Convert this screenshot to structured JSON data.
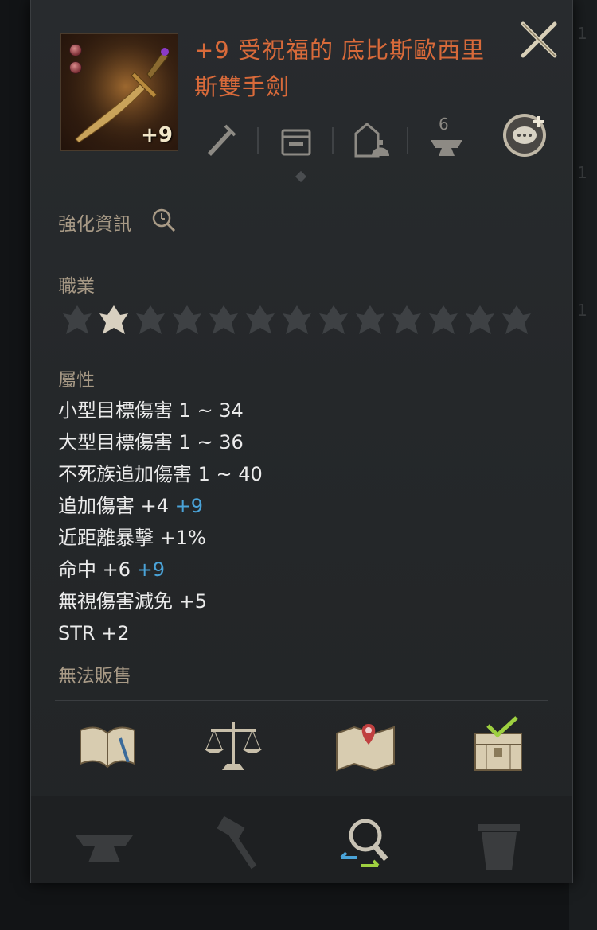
{
  "background": {
    "row_numbers": [
      "1",
      "1",
      "1"
    ]
  },
  "item": {
    "title": "+9 受祝福的 底比斯歐西里斯雙手劍",
    "enhance_badge": "+9",
    "thumbnail_icon": "two-handed-sword-icon"
  },
  "header_icons": {
    "count_badge": "6",
    "items": [
      "sword-type-icon",
      "storage-icon",
      "character-bag-icon",
      "anvil-icon",
      "chat-share-icon"
    ]
  },
  "sections": {
    "enhance_info_label": "強化資訊",
    "class_label": "職業",
    "attributes_label": "屬性"
  },
  "classes": [
    "class-1",
    "class-2",
    "class-3",
    "class-4",
    "class-5",
    "class-6",
    "class-7",
    "class-8",
    "class-9",
    "class-10",
    "class-11",
    "class-12",
    "class-13"
  ],
  "stats": [
    {
      "text": "小型目標傷害 1 ~ 34",
      "bonus": ""
    },
    {
      "text": "大型目標傷害 1 ~ 36",
      "bonus": ""
    },
    {
      "text": "不死族追加傷害 1 ~ 40",
      "bonus": ""
    },
    {
      "text": "追加傷害 +4",
      "bonus": "+9"
    },
    {
      "text": "近距離暴擊 +1%",
      "bonus": ""
    },
    {
      "text": "命中 +6",
      "bonus": "+9"
    },
    {
      "text": "無視傷害減免 +5",
      "bonus": ""
    },
    {
      "text": "STR +2",
      "bonus": ""
    }
  ],
  "footer_note": "無法販售",
  "colors": {
    "title": "#d86a3a",
    "bonus": "#4aa3d8",
    "label": "#a89a86"
  }
}
